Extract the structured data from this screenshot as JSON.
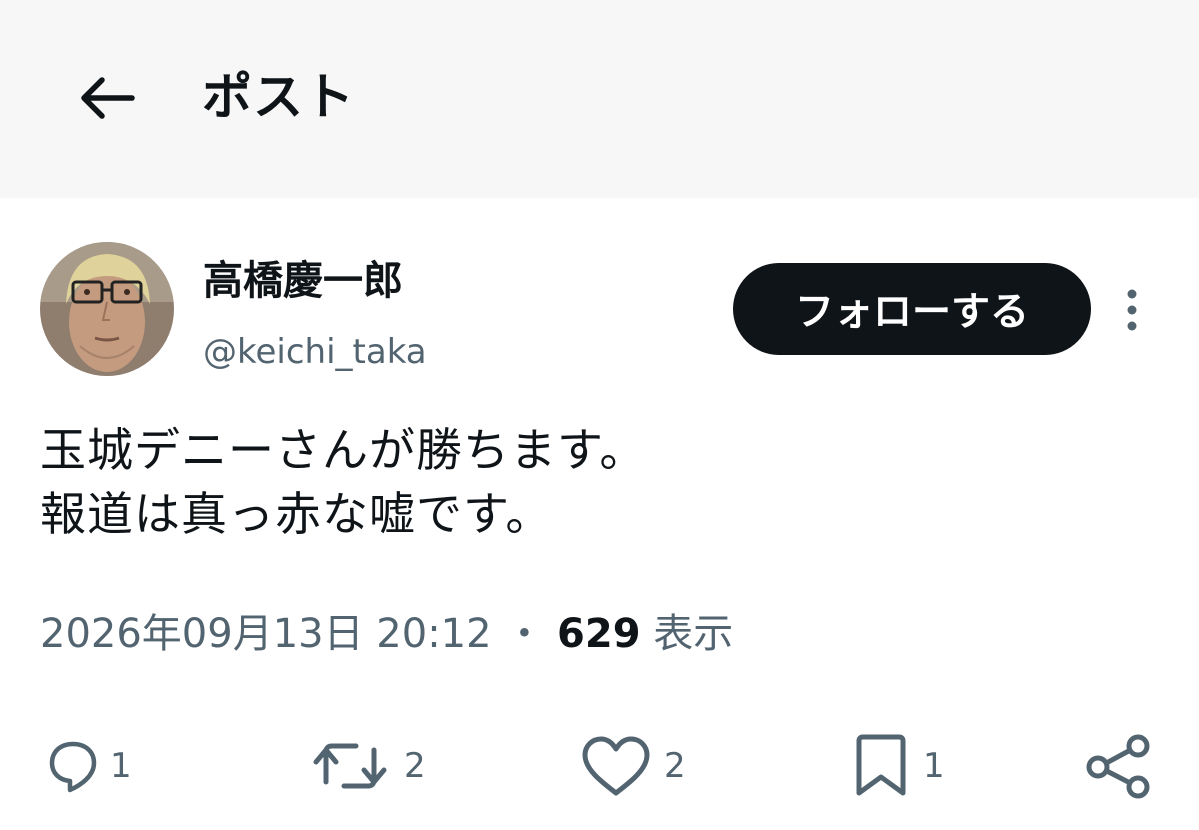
{
  "header": {
    "title": "ポスト",
    "back_icon": "arrow-left-icon"
  },
  "author": {
    "display_name": "高橋慶一郎",
    "handle": "@keichi_taka",
    "avatar_icon": "avatar-photo"
  },
  "follow_button": {
    "label": "フォローする"
  },
  "more_icon": "more-vertical-icon",
  "tweet": {
    "lines": [
      "玉城デニーさんが勝ちます。",
      "報道は真っ赤な嘘です。"
    ]
  },
  "meta": {
    "timestamp": "2026年09月13日 20:12",
    "separator": "・",
    "views_count": "629",
    "views_label": "表示"
  },
  "actions": {
    "reply": {
      "icon": "reply-icon",
      "count": "1"
    },
    "repost": {
      "icon": "repost-icon",
      "count": "2"
    },
    "like": {
      "icon": "heart-icon",
      "count": "2"
    },
    "bookmark": {
      "icon": "bookmark-icon",
      "count": "1"
    },
    "share": {
      "icon": "share-icon"
    }
  },
  "colors": {
    "text": "#0f1419",
    "secondary": "#536471",
    "header_bg": "#f7f7f7",
    "button_bg": "#0f1419"
  }
}
